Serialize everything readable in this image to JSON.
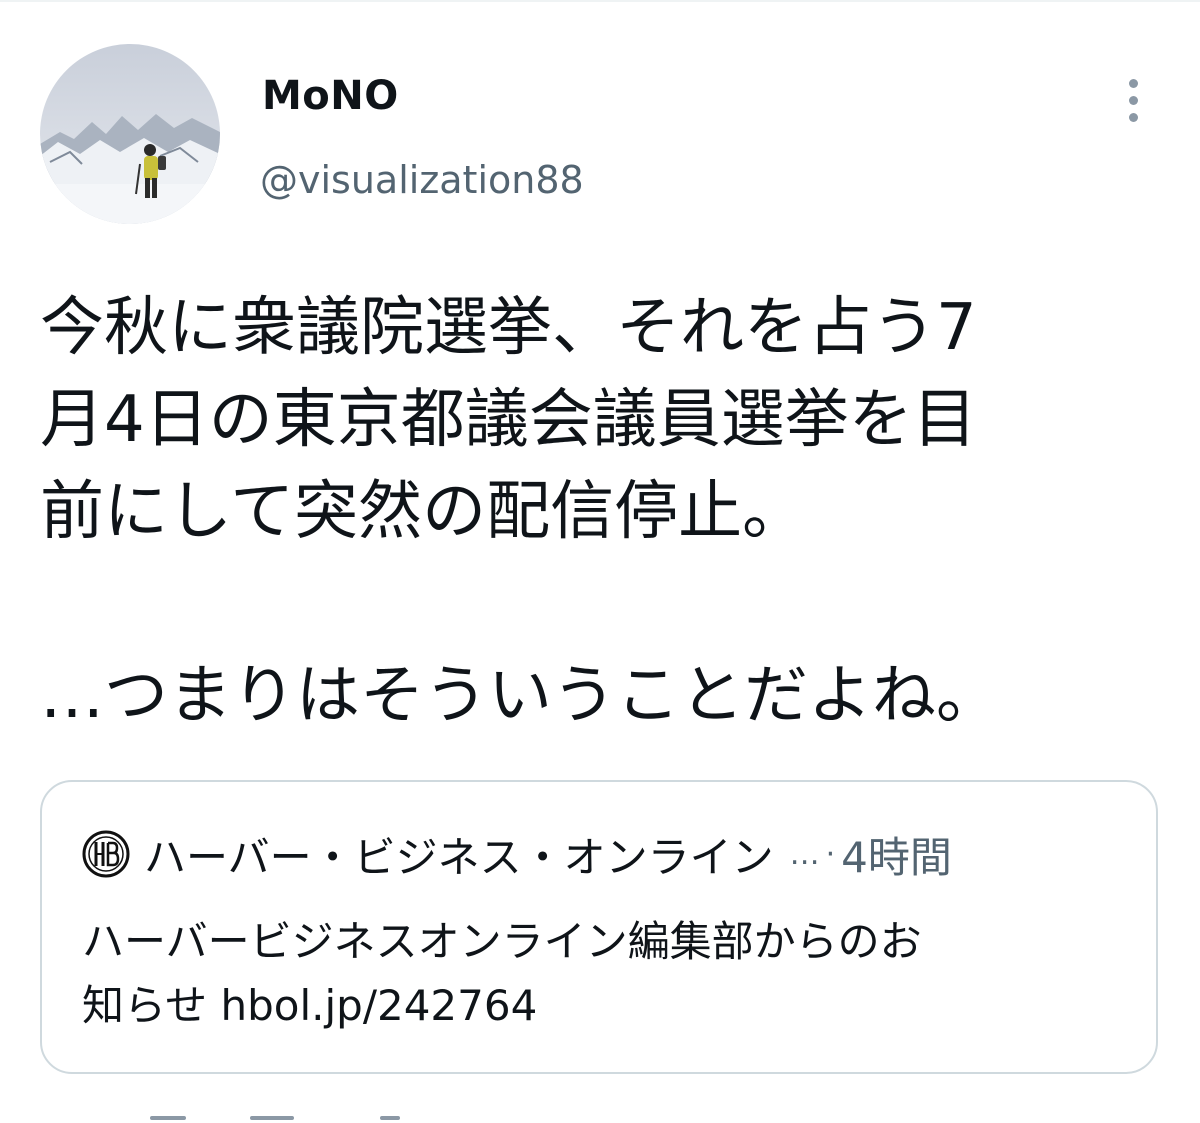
{
  "user": {
    "display_name": "MoNO",
    "handle": "@visualization88"
  },
  "tweet": {
    "lines": [
      "今秋に衆議院選挙、それを占う7",
      "月4日の東京都議会議員選挙を目",
      "前にして突然の配信停止。",
      "…つまりはそういうことだよね。"
    ]
  },
  "card": {
    "logo_icon": "hbo-logo-icon",
    "site_name": "ハーバー・ビジネス・オンライン",
    "ellipsis": "…",
    "separator": "·",
    "time": "4時間",
    "description_lines": [
      "ハーバービジネスオンライン編集部からのお",
      "知らせ hbol.jp/242764"
    ]
  },
  "icons": {
    "more": "more-vertical-icon",
    "avatar": "avatar-photo"
  },
  "colors": {
    "text": "#0f1419",
    "secondary": "#536471",
    "border": "#cfd9de"
  }
}
